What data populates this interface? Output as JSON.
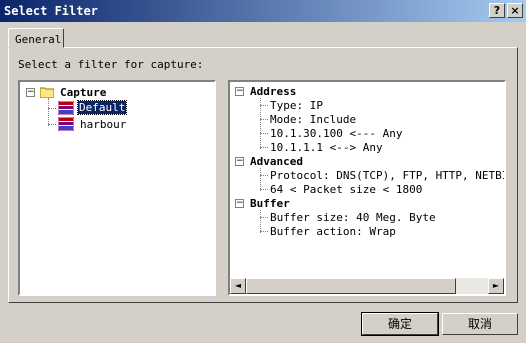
{
  "window": {
    "title": "Select Filter",
    "help_glyph": "?",
    "close_glyph": "×"
  },
  "tabs": [
    {
      "label": "General"
    }
  ],
  "prompt": "Select a filter for capture:",
  "tree": {
    "root": {
      "label": "Capture",
      "toggle": "−"
    },
    "items": [
      {
        "label": "Default",
        "selected": true
      },
      {
        "label": "harbour",
        "selected": false
      }
    ]
  },
  "details": {
    "sections": [
      {
        "title": "Address",
        "toggle": "−",
        "lines": [
          "Type: IP",
          "Mode: Include",
          "10.1.30.100 <--- Any",
          "10.1.1.1 <--> Any"
        ]
      },
      {
        "title": "Advanced",
        "toggle": "−",
        "lines": [
          "Protocol: DNS(TCP), FTP, HTTP, NETBIOS(",
          "64 < Packet size < 1800"
        ]
      },
      {
        "title": "Buffer",
        "toggle": "−",
        "lines": [
          "Buffer size: 40 Meg. Byte",
          "Buffer action: Wrap"
        ]
      }
    ],
    "scroll_left": "◄",
    "scroll_right": "►"
  },
  "buttons": {
    "ok": "确定",
    "cancel": "取消"
  },
  "colors": {
    "title_bar": "#0a246a",
    "selection": "#0a246a",
    "face": "#d4d0c8"
  }
}
